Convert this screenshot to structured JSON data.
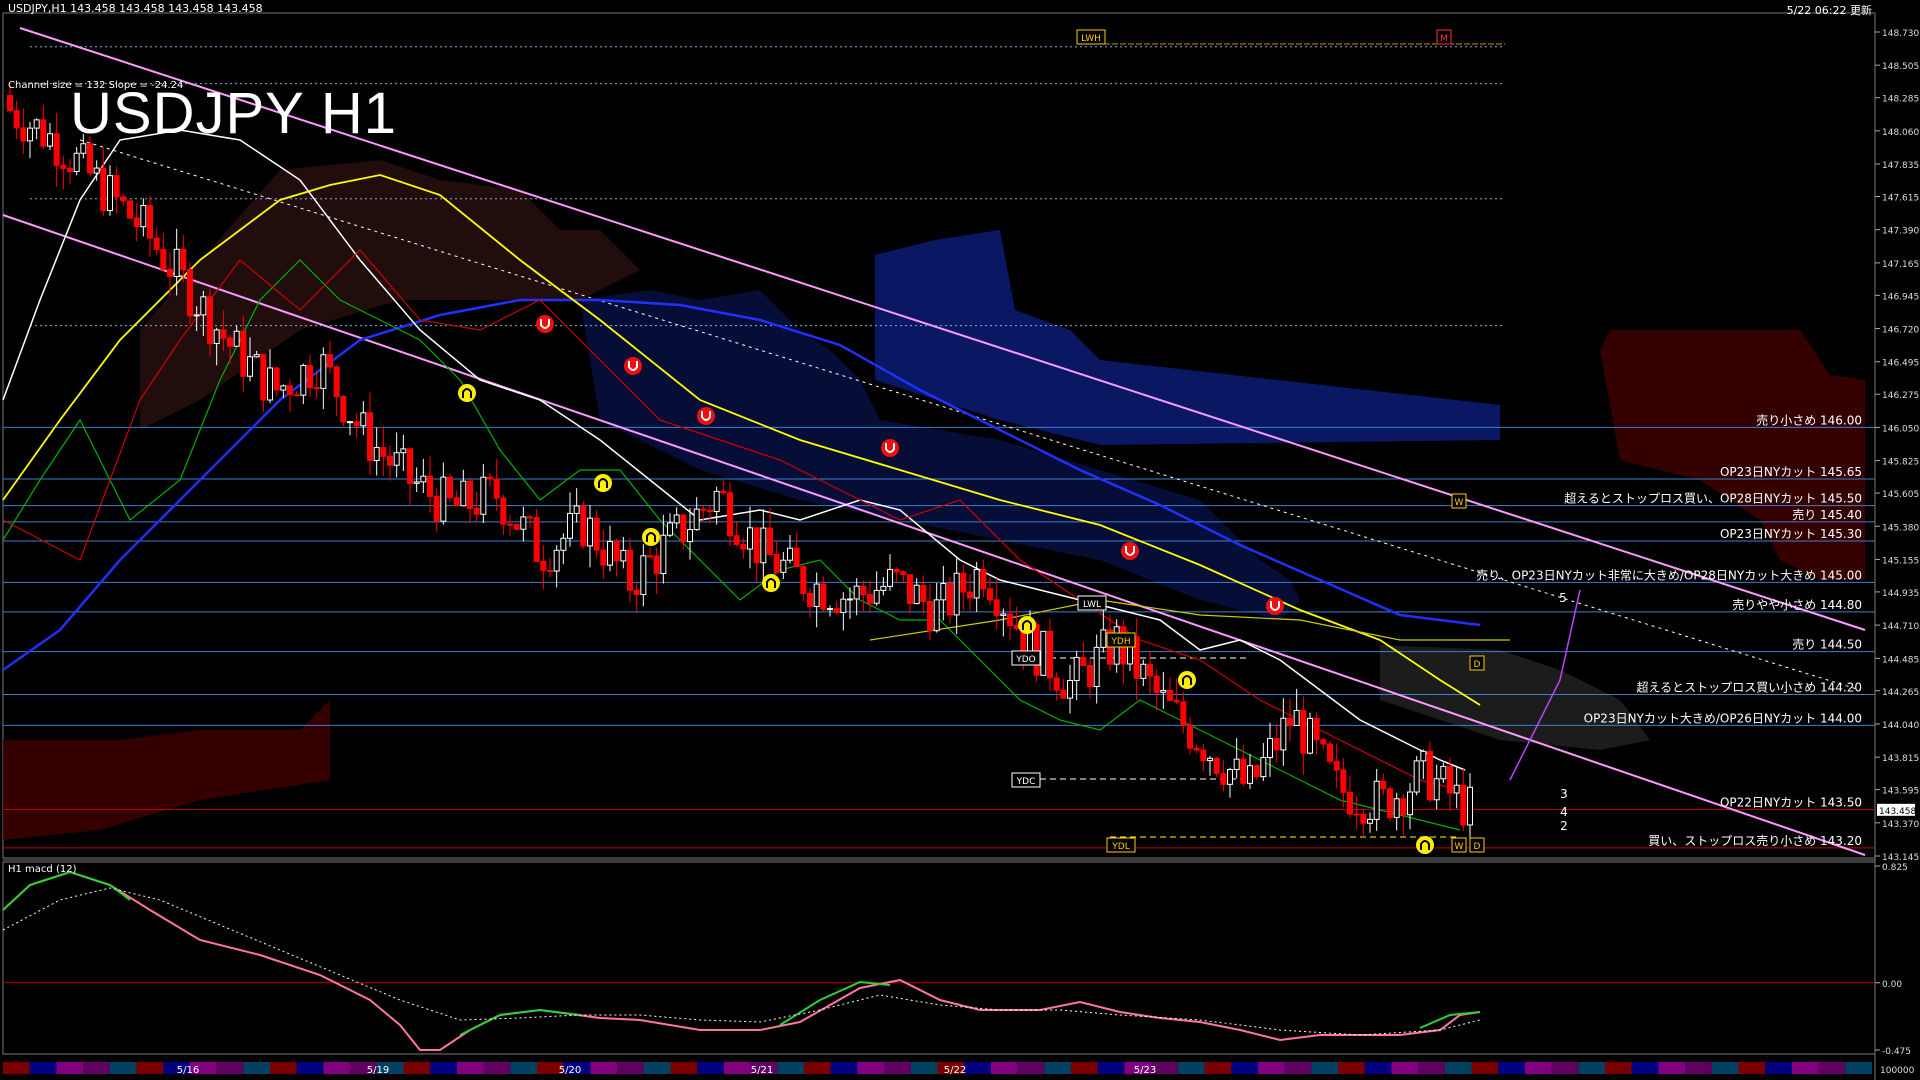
{
  "header": {
    "symbol_info": "USDJPY,H1  143.458 143.458 143.458 143.458",
    "updated": "5/22 06:22 更新"
  },
  "title": "USDJPY H1",
  "channel_info": "Channel size = 132 Slope = -24.24",
  "macd_label": "H1  macd (12)",
  "price_axis": {
    "min": 143.145,
    "max": 148.73,
    "ticks": [
      "148.730",
      "148.505",
      "148.285",
      "148.060",
      "147.835",
      "147.615",
      "147.390",
      "147.165",
      "146.945",
      "146.720",
      "146.495",
      "146.275",
      "146.050",
      "145.825",
      "145.605",
      "145.380",
      "145.155",
      "144.935",
      "144.710",
      "144.485",
      "144.265",
      "144.040",
      "143.815",
      "143.595",
      "143.370",
      "143.145"
    ],
    "current": "143.458"
  },
  "macd_axis": {
    "ticks": [
      "0.825",
      "0.00",
      "-0.475"
    ],
    "min": -0.475,
    "max": 0.825
  },
  "volume_label": "100000",
  "dates": [
    "5/16",
    "5/19",
    "5/20",
    "5/21",
    "5/22",
    "5/23"
  ],
  "level_labels": [
    {
      "text": "売り小さめ 146.00",
      "price": 146.05
    },
    {
      "text": "OP23日NYカット 145.65",
      "price": 145.7
    },
    {
      "text": "超えるとストップロス買い、OP28日NYカット 145.50",
      "price": 145.52
    },
    {
      "text": "売り 145.40",
      "price": 145.41
    },
    {
      "text": "OP23日NYカット 145.30",
      "price": 145.28
    },
    {
      "text": "売り、OP23日NYカット非常に大きめ/OP28日NYカット大きめ 145.00",
      "price": 145.0
    },
    {
      "text": "売りやや小さめ 144.80",
      "price": 144.8
    },
    {
      "text": "売り 144.50",
      "price": 144.53
    },
    {
      "text": "超えるとストップロス買い小さめ 144.20",
      "price": 144.24
    },
    {
      "text": "OP23日NYカット大きめ/OP26日NYカット 144.00",
      "price": 144.03
    },
    {
      "text": "OP22日NYカット 143.50",
      "price": 143.46
    },
    {
      "text": "買い、ストップロス売り小さめ 143.20",
      "price": 143.2
    }
  ],
  "boxes": [
    {
      "text": "LWH"
    },
    {
      "text": "M"
    },
    {
      "text": "YDH"
    },
    {
      "text": "YDO"
    },
    {
      "text": "YDC"
    },
    {
      "text": "YDL"
    },
    {
      "text": "LWL"
    },
    {
      "text": "W"
    },
    {
      "text": "D"
    },
    {
      "text": "W"
    },
    {
      "text": "D"
    }
  ],
  "wave_labels": [
    "5",
    "3",
    "4",
    "2"
  ],
  "colors": {
    "bull": "#ffffff",
    "bear": "#ff0000",
    "yellow": "#ffff00",
    "blue": "#0000ff",
    "pink": "#ff88ff",
    "green": "#00c000",
    "cyan_lines": "#4a90d0"
  },
  "chart_data": {
    "type": "line",
    "title": "USDJPY H1",
    "series": [
      {
        "name": "USDJPY",
        "values": [
          148.2,
          148.0,
          147.7,
          147.4,
          147.0,
          146.6,
          146.3,
          146.5,
          146.0,
          145.7,
          145.5,
          145.6,
          145.2,
          145.4,
          145.0,
          145.3,
          145.6,
          145.2,
          145.0,
          144.9,
          145.0,
          144.8,
          145.1,
          144.6,
          144.3,
          144.6,
          144.2,
          143.9,
          143.6,
          144.1,
          143.6,
          143.5,
          143.7,
          143.46
        ]
      }
    ],
    "ylim": [
      143.145,
      148.73
    ]
  }
}
